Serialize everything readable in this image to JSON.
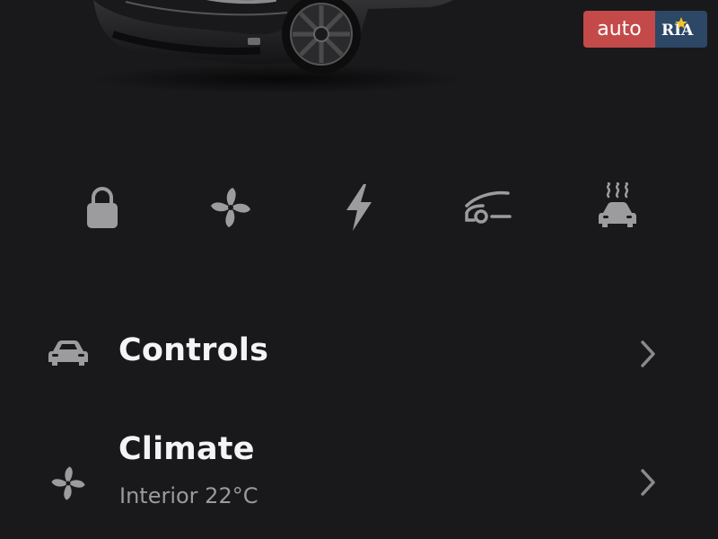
{
  "watermark": {
    "brand_left": "auto",
    "brand_right": "RIA"
  },
  "quick_actions": [
    {
      "icon": "lock-icon",
      "label": "Lock"
    },
    {
      "icon": "fan-icon",
      "label": "Climate"
    },
    {
      "icon": "lightning-icon",
      "label": "Charge"
    },
    {
      "icon": "frunk-icon",
      "label": "Frunk"
    },
    {
      "icon": "heated-car-icon",
      "label": "Defrost"
    }
  ],
  "menu": {
    "controls": {
      "title": "Controls"
    },
    "climate": {
      "title": "Climate",
      "subtitle": "Interior 22°C"
    }
  },
  "colors": {
    "background": "#19191b",
    "icon": "#9c9c9e",
    "title": "#f4f4f4",
    "subtitle": "#9a9a9c",
    "watermark_red": "#c44a4a",
    "watermark_blue": "#2d4766"
  }
}
